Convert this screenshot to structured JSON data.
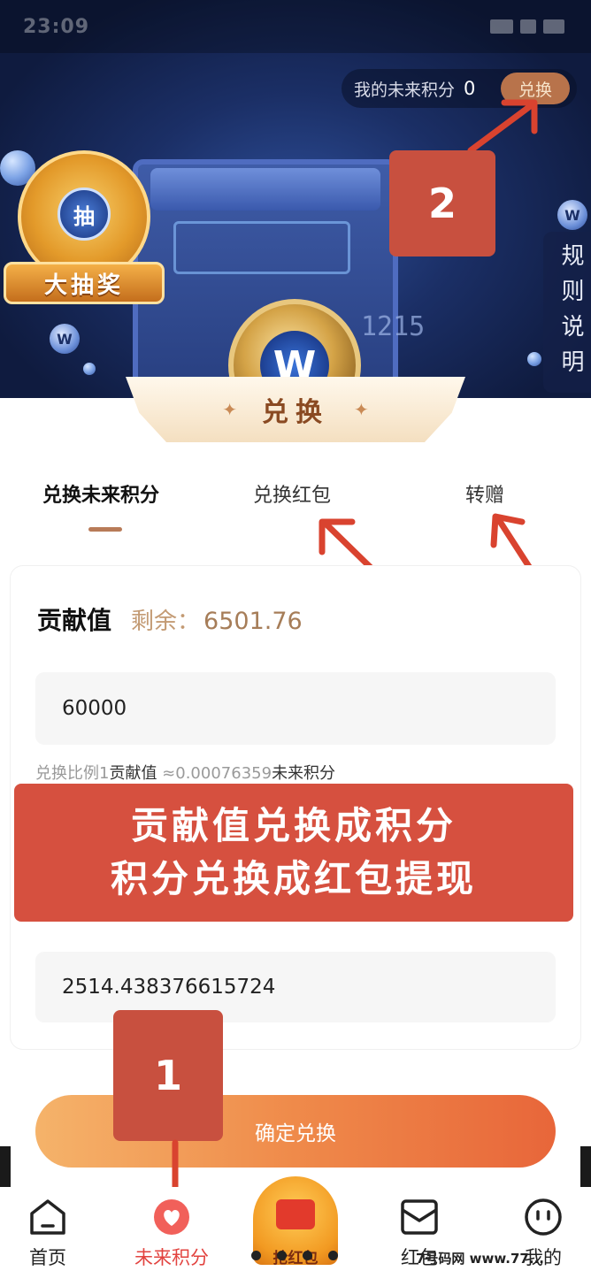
{
  "status_bar": {
    "time": "23:09"
  },
  "header": {
    "points_label": "我的未来积分",
    "points_value": "0",
    "exchange_button": "兑换"
  },
  "lottery": {
    "coin_char": "抽",
    "label": "大抽奖"
  },
  "hero": {
    "coin_symbol": "W",
    "counter_text": "1215"
  },
  "rules_tab": "规则说明",
  "section_title": "兑换",
  "tabs": [
    {
      "label": "兑换未来积分",
      "active": true
    },
    {
      "label": "兑换红包",
      "active": false
    },
    {
      "label": "转赠",
      "active": false
    }
  ],
  "card": {
    "contribution_label": "贡献值",
    "remaining_label": "剩余：",
    "remaining_value": "6501.76",
    "amount_input_value": "60000",
    "ratio_prefix": "兑换比例1",
    "ratio_unit_from": "贡献值",
    "ratio_value": " ≈0.00076359",
    "ratio_unit_to": "未来积分",
    "result_value": "2514.438376615724"
  },
  "promo_banner": {
    "line1": "贡献值兑换成积分",
    "line2": "积分兑换成红包提现"
  },
  "confirm_button": "确定兑换",
  "annotations": {
    "step1": "1",
    "step2": "2"
  },
  "bottom_nav": {
    "items": [
      {
        "label": "首页",
        "icon": "home-icon"
      },
      {
        "label": "未来积分",
        "icon": "heart-icon"
      },
      {
        "label": "抢红包",
        "icon": "red-envelope-icon"
      },
      {
        "label": "红包",
        "icon": "envelope-icon"
      },
      {
        "label": "我的",
        "icon": "profile-icon"
      }
    ]
  },
  "watermark": "7号码网 www.77...",
  "colors": {
    "accent_brown": "#b87b58",
    "annotation_red": "#c8503f",
    "nav_active": "#e2433f",
    "button_gradient_start": "#f5b36a",
    "button_gradient_end": "#e8663a"
  }
}
